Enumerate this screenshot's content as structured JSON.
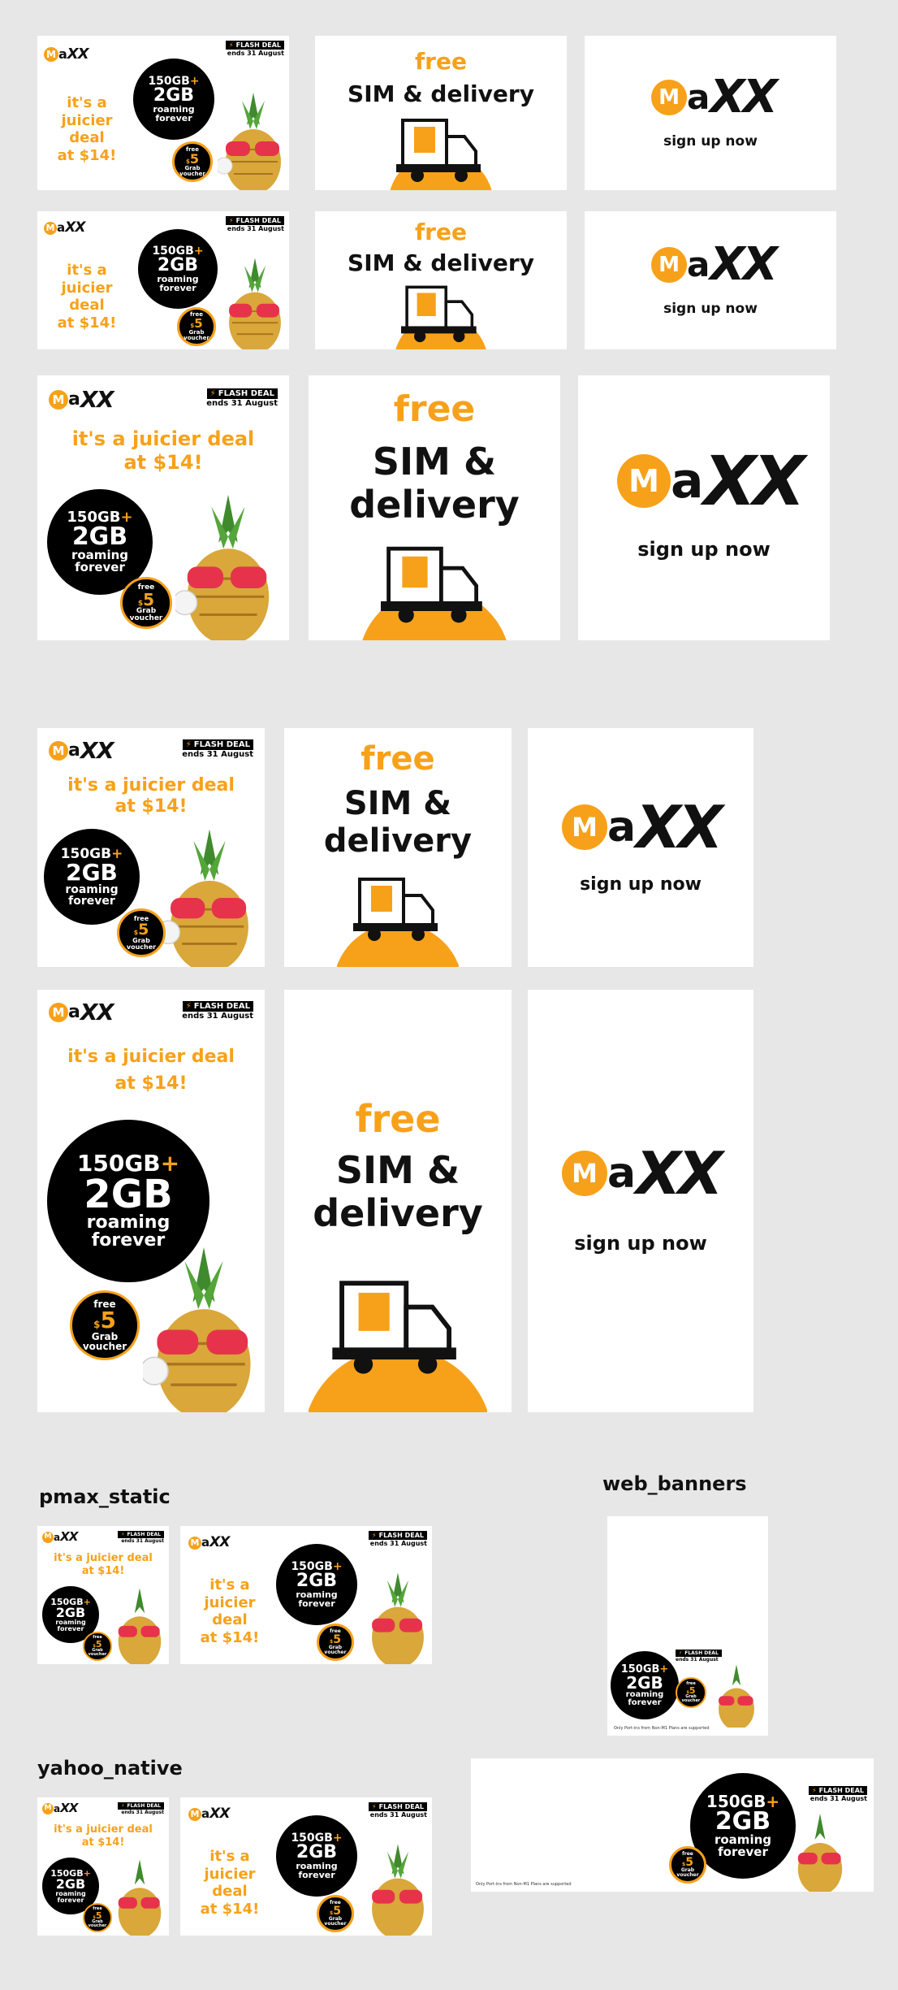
{
  "brand": {
    "logo_m": "M",
    "logo_a": "a",
    "logo_xx": "XX",
    "accent": "#f7a11a"
  },
  "offer": {
    "headline": "it's a juicier deal at $14!",
    "headline_l1": "it's a",
    "headline_l2": "juicier deal",
    "headline_l3": "at $14!",
    "headline_w1": "it's a juicier deal",
    "data_main": "150GB",
    "data_plus": "+",
    "data_extra": "2GB",
    "roaming_l1": "roaming",
    "roaming_l2": "forever",
    "voucher_free": "free",
    "voucher_dollar": "$",
    "voucher_amount": "5",
    "voucher_grab": "Grab",
    "voucher_word": "voucher",
    "flash_label": "FLASH DEAL",
    "flash_ends": "ends 31 August",
    "fine_print": "Only Port-ins from Non-M1 Plans are supported"
  },
  "sim_card": {
    "free": "free",
    "line1": "SIM & delivery",
    "line_sim": "SIM &",
    "line_delivery": "delivery"
  },
  "signup": {
    "label": "sign up now"
  },
  "sections": {
    "pmax": "pmax_static",
    "web": "web_banners",
    "yahoo": "yahoo_native"
  }
}
